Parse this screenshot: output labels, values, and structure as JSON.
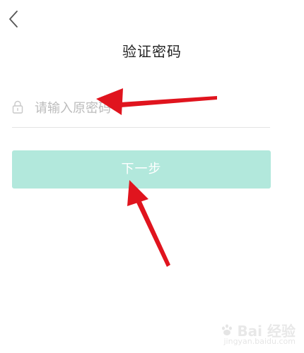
{
  "header": {
    "title": "验证密码",
    "back_icon": "chevron-left-icon"
  },
  "form": {
    "password_placeholder": "请输入原密码",
    "password_value": "",
    "lock_icon": "lock-icon"
  },
  "actions": {
    "next_label": "下一步"
  },
  "colors": {
    "button_bg": "#b2e8dc",
    "arrow": "#e0141e"
  },
  "watermark": {
    "text": "Bai  经验",
    "sub": "jingyan.baidu.com"
  }
}
